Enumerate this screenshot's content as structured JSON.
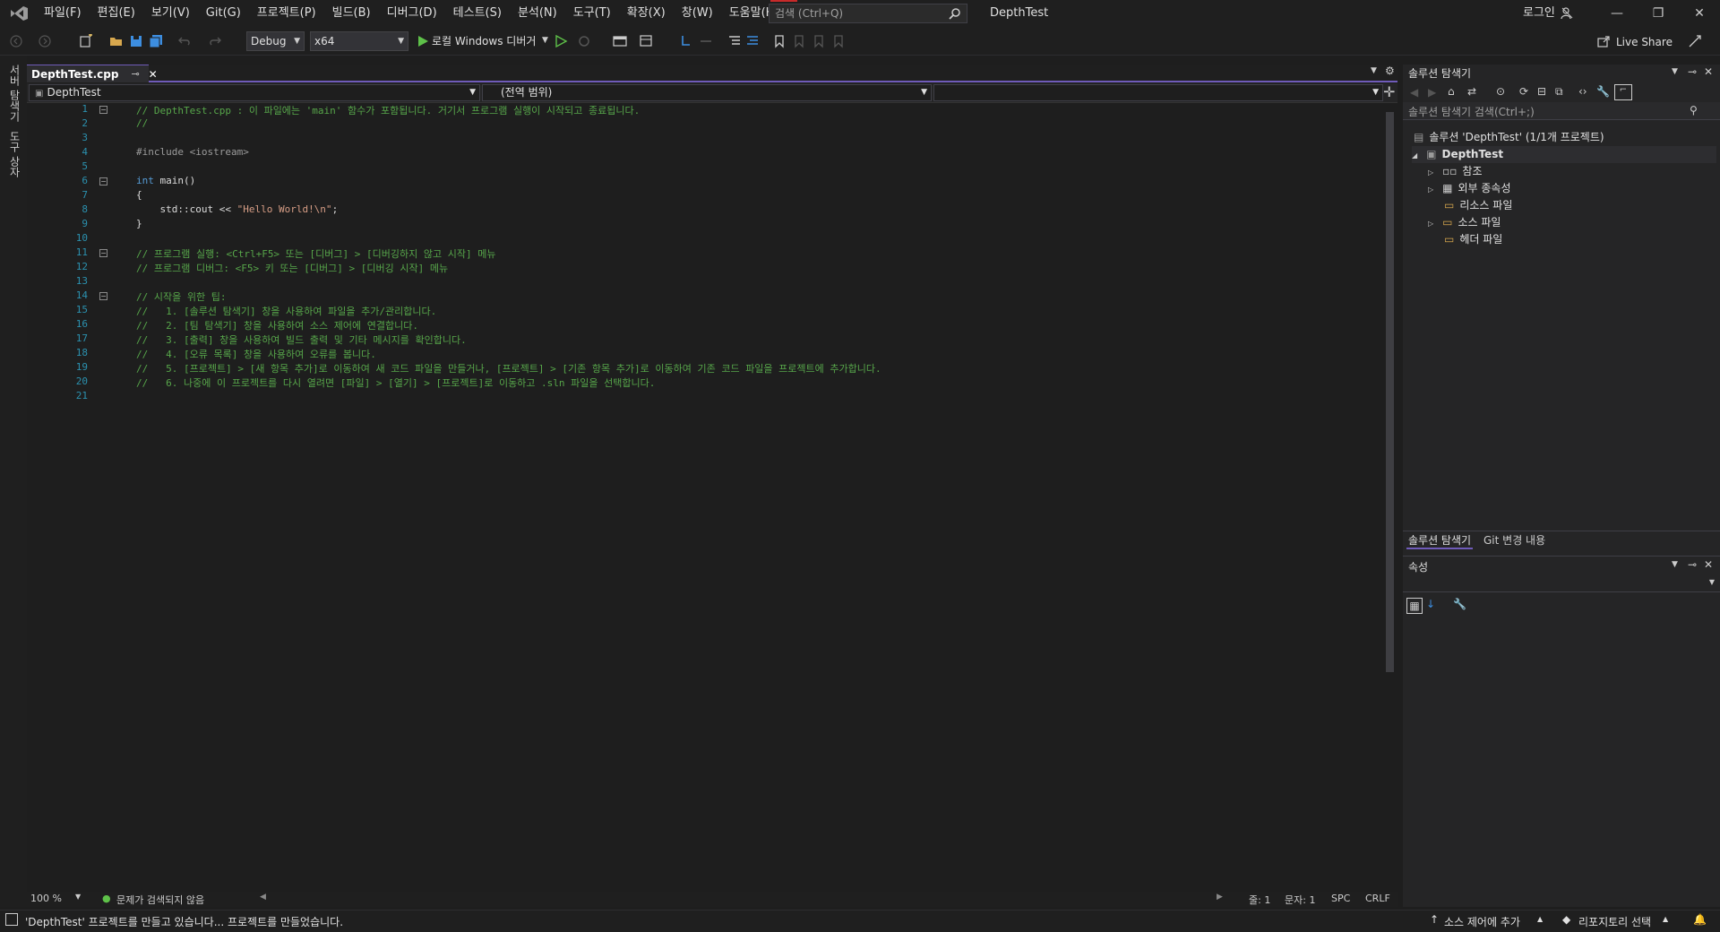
{
  "menu": [
    "파일(F)",
    "편집(E)",
    "보기(V)",
    "Git(G)",
    "프로젝트(P)",
    "빌드(B)",
    "디버그(D)",
    "테스트(S)",
    "분석(N)",
    "도구(T)",
    "확장(X)",
    "창(W)",
    "도움말(H)"
  ],
  "search": {
    "placeholder": "검색 (Ctrl+Q)"
  },
  "title": "DepthTest",
  "login": "로그인",
  "toolbar": {
    "config": "Debug",
    "platform": "x64",
    "run_label": "로컬 Windows 디버거",
    "live_share": "Live Share"
  },
  "left_strip": {
    "server_explorer": "서버 탐색기",
    "toolbox": "도구 상자"
  },
  "editor": {
    "tab_name": "DepthTest.cpp",
    "nav_project": "DepthTest",
    "nav_scope": "(전역 범위)",
    "line_numbers": [
      "1",
      "2",
      "3",
      "4",
      "5",
      "6",
      "7",
      "8",
      "9",
      "10",
      "11",
      "12",
      "13",
      "14",
      "15",
      "16",
      "17",
      "18",
      "19",
      "20",
      "21"
    ],
    "lines": {
      "l1": "// DepthTest.cpp : 이 파일에는 'main' 함수가 포함됩니다. 거기서 프로그램 실행이 시작되고 종료됩니다.",
      "l2": "//",
      "l4": "#include <iostream>",
      "l6_kw": "int",
      "l6_rest": " main()",
      "l7": "{",
      "l8_a": "    std::cout << ",
      "l8_str": "\"Hello World!\\n\"",
      "l8_b": ";",
      "l9": "}",
      "l11": "// 프로그램 실행: <Ctrl+F5> 또는 [디버그] > [디버깅하지 않고 시작] 메뉴",
      "l12": "// 프로그램 디버그: <F5> 키 또는 [디버그] > [디버깅 시작] 메뉴",
      "l14": "// 시작을 위한 팁:",
      "l15": "//   1. [솔루션 탐색기] 창을 사용하여 파일을 추가/관리합니다.",
      "l16": "//   2. [팀 탐색기] 창을 사용하여 소스 제어에 연결합니다.",
      "l17": "//   3. [출력] 창을 사용하여 빌드 출력 및 기타 메시지를 확인합니다.",
      "l18": "//   4. [오류 목록] 창을 사용하여 오류를 봅니다.",
      "l19": "//   5. [프로젝트] > [새 항목 추가]로 이동하여 새 코드 파일을 만들거나, [프로젝트] > [기존 항목 추가]로 이동하여 기존 코드 파일을 프로젝트에 추가합니다.",
      "l20": "//   6. 나중에 이 프로젝트를 다시 열려면 [파일] > [열기] > [프로젝트]로 이동하고 .sln 파일을 선택합니다."
    },
    "zoom": "100 %",
    "issues": "문제가 검색되지 않음",
    "line": "줄: 1",
    "col": "문자: 1",
    "spc": "SPC",
    "crlf": "CRLF"
  },
  "solution_explorer": {
    "header": "솔루션 탐색기",
    "search_placeholder": "솔루션 탐색기 검색(Ctrl+;)",
    "solution_node": "솔루션 'DepthTest' (1/1개 프로젝트)",
    "project_node": "DepthTest",
    "items": [
      "참조",
      "외부 종속성",
      "리소스 파일",
      "소스 파일",
      "헤더 파일"
    ],
    "tab_solution": "솔루션 탐색기",
    "tab_git": "Git 변경 내용"
  },
  "properties": {
    "header": "속성"
  },
  "status": {
    "message": "'DepthTest' 프로젝트를 만들고 있습니다... 프로젝트를 만들었습니다.",
    "source_control": "소스 제어에 추가",
    "repository": "리포지토리 선택"
  },
  "colors": {
    "accent": "#6f5bb9",
    "comment": "#57a64a",
    "keyword": "#569cd6",
    "string": "#d69d85",
    "linenumber": "#2b91af"
  }
}
